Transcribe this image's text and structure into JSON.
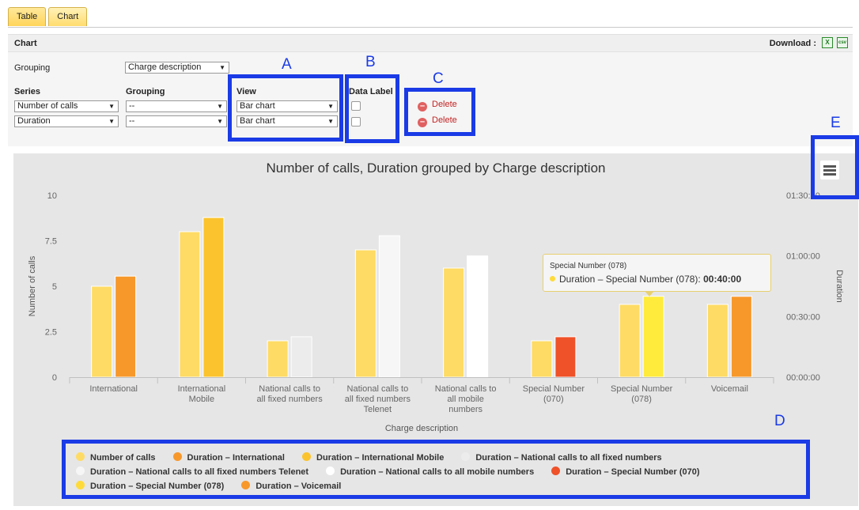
{
  "tabs": [
    {
      "label": "Table"
    },
    {
      "label": "Chart"
    }
  ],
  "panel": {
    "title": "Chart",
    "download_label": "Download :"
  },
  "download_icons": {
    "xls": "excel-icon",
    "csv": "csv-icon",
    "xls_glyph": "X",
    "csv_glyph": "csv"
  },
  "top_grouping": {
    "label": "Grouping",
    "value": "Charge description"
  },
  "headers": {
    "series": "Series",
    "grouping": "Grouping",
    "view": "View",
    "data_label": "Data Label"
  },
  "rows": [
    {
      "series": "Number of calls",
      "grouping": "--",
      "view": "Bar chart",
      "delete": "Delete"
    },
    {
      "series": "Duration",
      "grouping": "--",
      "view": "Bar chart",
      "delete": "Delete"
    }
  ],
  "annotations": {
    "A": "A",
    "B": "B",
    "C": "C",
    "D": "D",
    "E": "E"
  },
  "accent_blue": "#1a3be6",
  "chart_data": {
    "type": "bar",
    "title": "Number of calls, Duration grouped by Charge description",
    "xlabel": "Charge description",
    "ylabel": "Number of calls",
    "y2label": "Duration",
    "ylim": [
      0,
      10
    ],
    "yticks": [
      "0",
      "2.5",
      "5",
      "7.5",
      "10"
    ],
    "y2ticks": [
      "00:00:00",
      "00:30:00",
      "01:00:00",
      "01:30:00"
    ],
    "categories": [
      [
        "International"
      ],
      [
        "International",
        "Mobile"
      ],
      [
        "National calls to",
        "all fixed numbers"
      ],
      [
        "National calls to",
        "all fixed numbers",
        "Telenet"
      ],
      [
        "National calls to",
        "all mobile",
        "numbers"
      ],
      [
        "Special Number",
        "(070)"
      ],
      [
        "Special Number",
        "(078)"
      ],
      [
        "Voicemail"
      ]
    ],
    "series": [
      {
        "name": "Number of calls",
        "values": [
          5,
          8,
          2,
          7,
          6,
          2,
          4,
          4
        ]
      },
      {
        "name": "Duration",
        "values_minutes": [
          50,
          79,
          20,
          70,
          60,
          20,
          40,
          40
        ],
        "colors": [
          "#f7982b",
          "#fbc32d",
          "#ececec",
          "#f6f6f6",
          "#ffffff",
          "#ef5128",
          "#ffeb3b",
          "#f7982b"
        ]
      }
    ],
    "number_color": "#fedb64",
    "legend": [
      {
        "label": "Number of calls",
        "color": "#fedb64"
      },
      {
        "label": "Duration – International",
        "color": "#f7982b"
      },
      {
        "label": "Duration – International Mobile",
        "color": "#fbc32d"
      },
      {
        "label": "Duration – National calls to all fixed numbers",
        "color": "#ececec"
      },
      {
        "label": "Duration – National calls to all fixed numbers Telenet",
        "color": "#f6f6f6"
      },
      {
        "label": "Duration – National calls to all mobile numbers",
        "color": "#ffffff"
      },
      {
        "label": "Duration – Special Number (070)",
        "color": "#ef5128"
      },
      {
        "label": "Duration – Special Number (078)",
        "color": "#fedb3b"
      },
      {
        "label": "Duration – Voicemail",
        "color": "#f7982b"
      }
    ],
    "legend_placement": "bottom",
    "tooltip": {
      "title": "Special Number (078)",
      "label": "Duration – Special Number (078): ",
      "value": "00:40:00"
    }
  }
}
